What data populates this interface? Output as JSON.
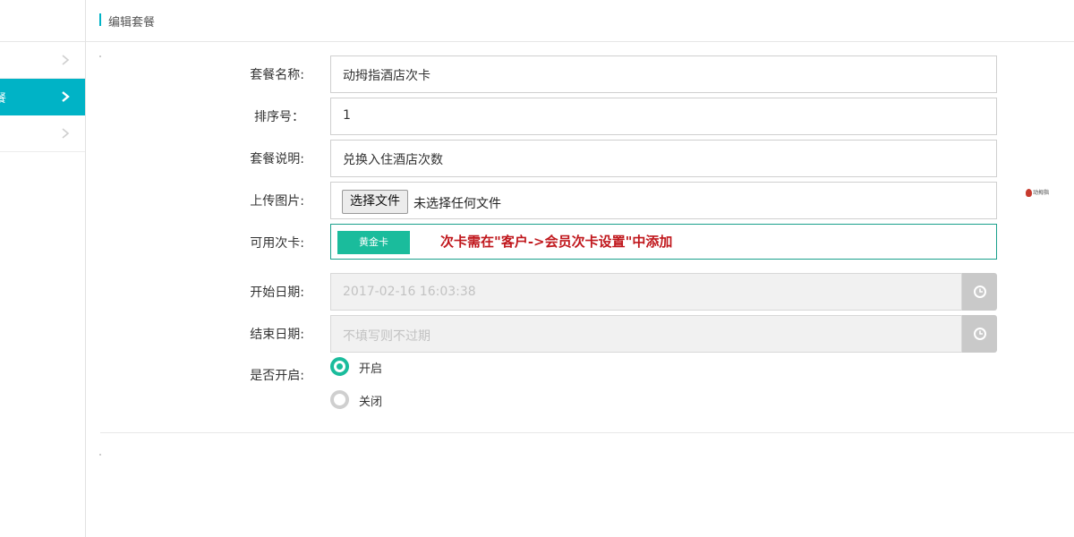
{
  "header": {
    "title": "编辑套餐"
  },
  "sidebar": {
    "active_label": "餐"
  },
  "form": {
    "name": {
      "label": "套餐名称:",
      "value": "动拇指酒店次卡"
    },
    "sort": {
      "label": "排序号：",
      "value": "1"
    },
    "desc": {
      "label": "套餐说明:",
      "value": "兑换入住酒店次数"
    },
    "upload": {
      "label": "上传图片:",
      "button": "选择文件",
      "status": "未选择任何文件"
    },
    "cards": {
      "label": "可用次卡:",
      "badge": "黄金卡",
      "note": "次卡需在\"客户->会员次卡设置\"中添加"
    },
    "start_date": {
      "label": "开始日期:",
      "placeholder": "2017-02-16 16:03:38"
    },
    "end_date": {
      "label": "结束日期:",
      "placeholder": "不填写则不过期"
    },
    "enabled": {
      "label": "是否开启:",
      "options": [
        "开启",
        "关闭"
      ],
      "selected": "开启"
    }
  },
  "colors": {
    "accent": "#00b3c6",
    "green": "#1abc9c",
    "note_red": "#c0171c"
  },
  "logo": {
    "text": "动拇指"
  }
}
